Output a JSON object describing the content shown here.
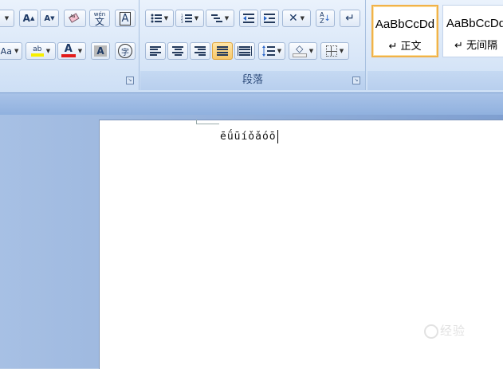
{
  "font_group": {
    "grow_font_label": "A",
    "shrink_font_label": "A",
    "phonetic_label": "wén",
    "phonetic_char": "文",
    "char_border_label": "A",
    "change_case_label": "Aa",
    "highlight_label": "ab",
    "font_color_label": "A",
    "char_shading_label": "A",
    "enclose_char_label": "字"
  },
  "paragraph_group": {
    "label": "段落"
  },
  "styles_group": {
    "items": [
      {
        "sample": "AaBbCcDd",
        "name": "↵ 正文"
      },
      {
        "sample": "AaBbCcDd",
        "name": "↵ 无间隔"
      }
    ]
  },
  "colors": {
    "highlight": "#f7ef00",
    "font_color": "#e21b1b",
    "active_button": "#f8c86a"
  },
  "document": {
    "text": "ēǘūíǒǎóō"
  },
  "watermark": {
    "text": "经验"
  }
}
